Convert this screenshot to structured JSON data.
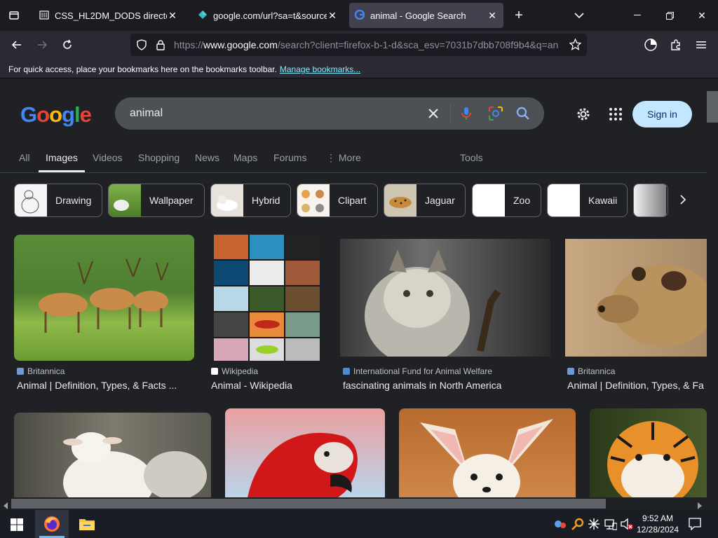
{
  "browser": {
    "tabs": [
      {
        "title": "CSS_HL2DM_DODS directory lis",
        "icon": "archive-icon"
      },
      {
        "title": "google.com/url?sa=t&source=",
        "icon": "gem-icon"
      },
      {
        "title": "animal - Google Search",
        "icon": "google-icon",
        "active": true
      }
    ],
    "url": {
      "prefix": "https://",
      "host": "www.google.com",
      "path": "/search?client=firefox-b-1-d&sca_esv=7031b7dbb708f9b4&q=an"
    },
    "bookmarks_hint": "For quick access, place your bookmarks here on the bookmarks toolbar.",
    "bookmarks_link": "Manage bookmarks..."
  },
  "google": {
    "logo": "Google",
    "query": "animal",
    "signin": "Sign in",
    "tabs": [
      "All",
      "Images",
      "Videos",
      "Shopping",
      "News",
      "Maps",
      "Forums",
      "More"
    ],
    "tools": "Tools",
    "chips": [
      "Drawing",
      "Wallpaper",
      "Hybrid",
      "Clipart",
      "Jaguar",
      "Zoo",
      "Kawaii"
    ],
    "results_row1": [
      {
        "source": "Britannica",
        "title": "Animal | Definition, Types, & Facts ..."
      },
      {
        "source": "Wikipedia",
        "title": "Animal - Wikipedia"
      },
      {
        "source": "International Fund for Animal Welfare",
        "title": "fascinating animals in North America"
      },
      {
        "source": "Britannica",
        "title": "Animal | Definition, Types, & Fa"
      }
    ]
  },
  "taskbar": {
    "time": "9:52 AM",
    "date": "12/28/2024"
  },
  "colors": {
    "accent": "#8ab4f8",
    "signin_bg": "#c2e7ff",
    "page_bg": "#202124"
  }
}
